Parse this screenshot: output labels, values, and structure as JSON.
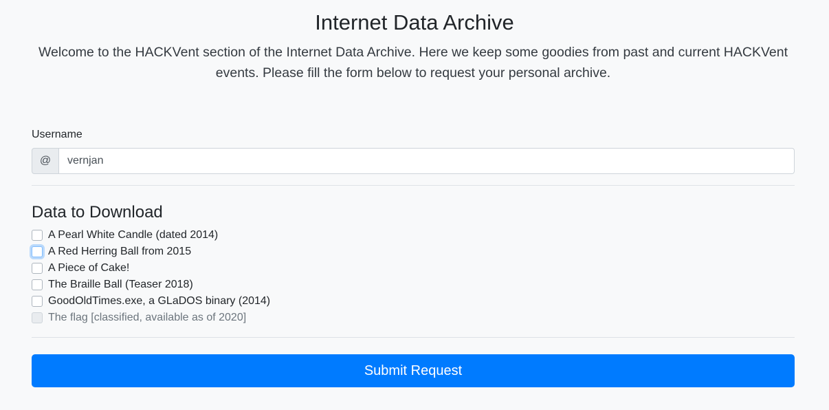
{
  "header": {
    "title": "Internet Data Archive",
    "lead": "Welcome to the HACKVent section of the Internet Data Archive. Here we keep some goodies from past and current HACKVent events. Please fill the form below to request your personal archive."
  },
  "username": {
    "label": "Username",
    "prefix": "@",
    "value": "vernjan"
  },
  "downloads": {
    "title": "Data to Download",
    "items": [
      {
        "label": "A Pearl White Candle (dated 2014)",
        "checked": false,
        "disabled": false
      },
      {
        "label": "A Red Herring Ball from 2015",
        "checked": false,
        "disabled": false,
        "focused": true
      },
      {
        "label": "A Piece of Cake!",
        "checked": false,
        "disabled": false
      },
      {
        "label": "The Braille Ball (Teaser 2018)",
        "checked": false,
        "disabled": false
      },
      {
        "label": "GoodOldTimes.exe, a GLaDOS binary (2014)",
        "checked": false,
        "disabled": false
      },
      {
        "label": "The flag [classified, available as of 2020]",
        "checked": false,
        "disabled": true
      }
    ]
  },
  "submit": {
    "label": "Submit Request"
  },
  "colors": {
    "primary": "#007bff",
    "background": "#f8f9fa",
    "text": "#212529",
    "muted": "#6c757d"
  }
}
